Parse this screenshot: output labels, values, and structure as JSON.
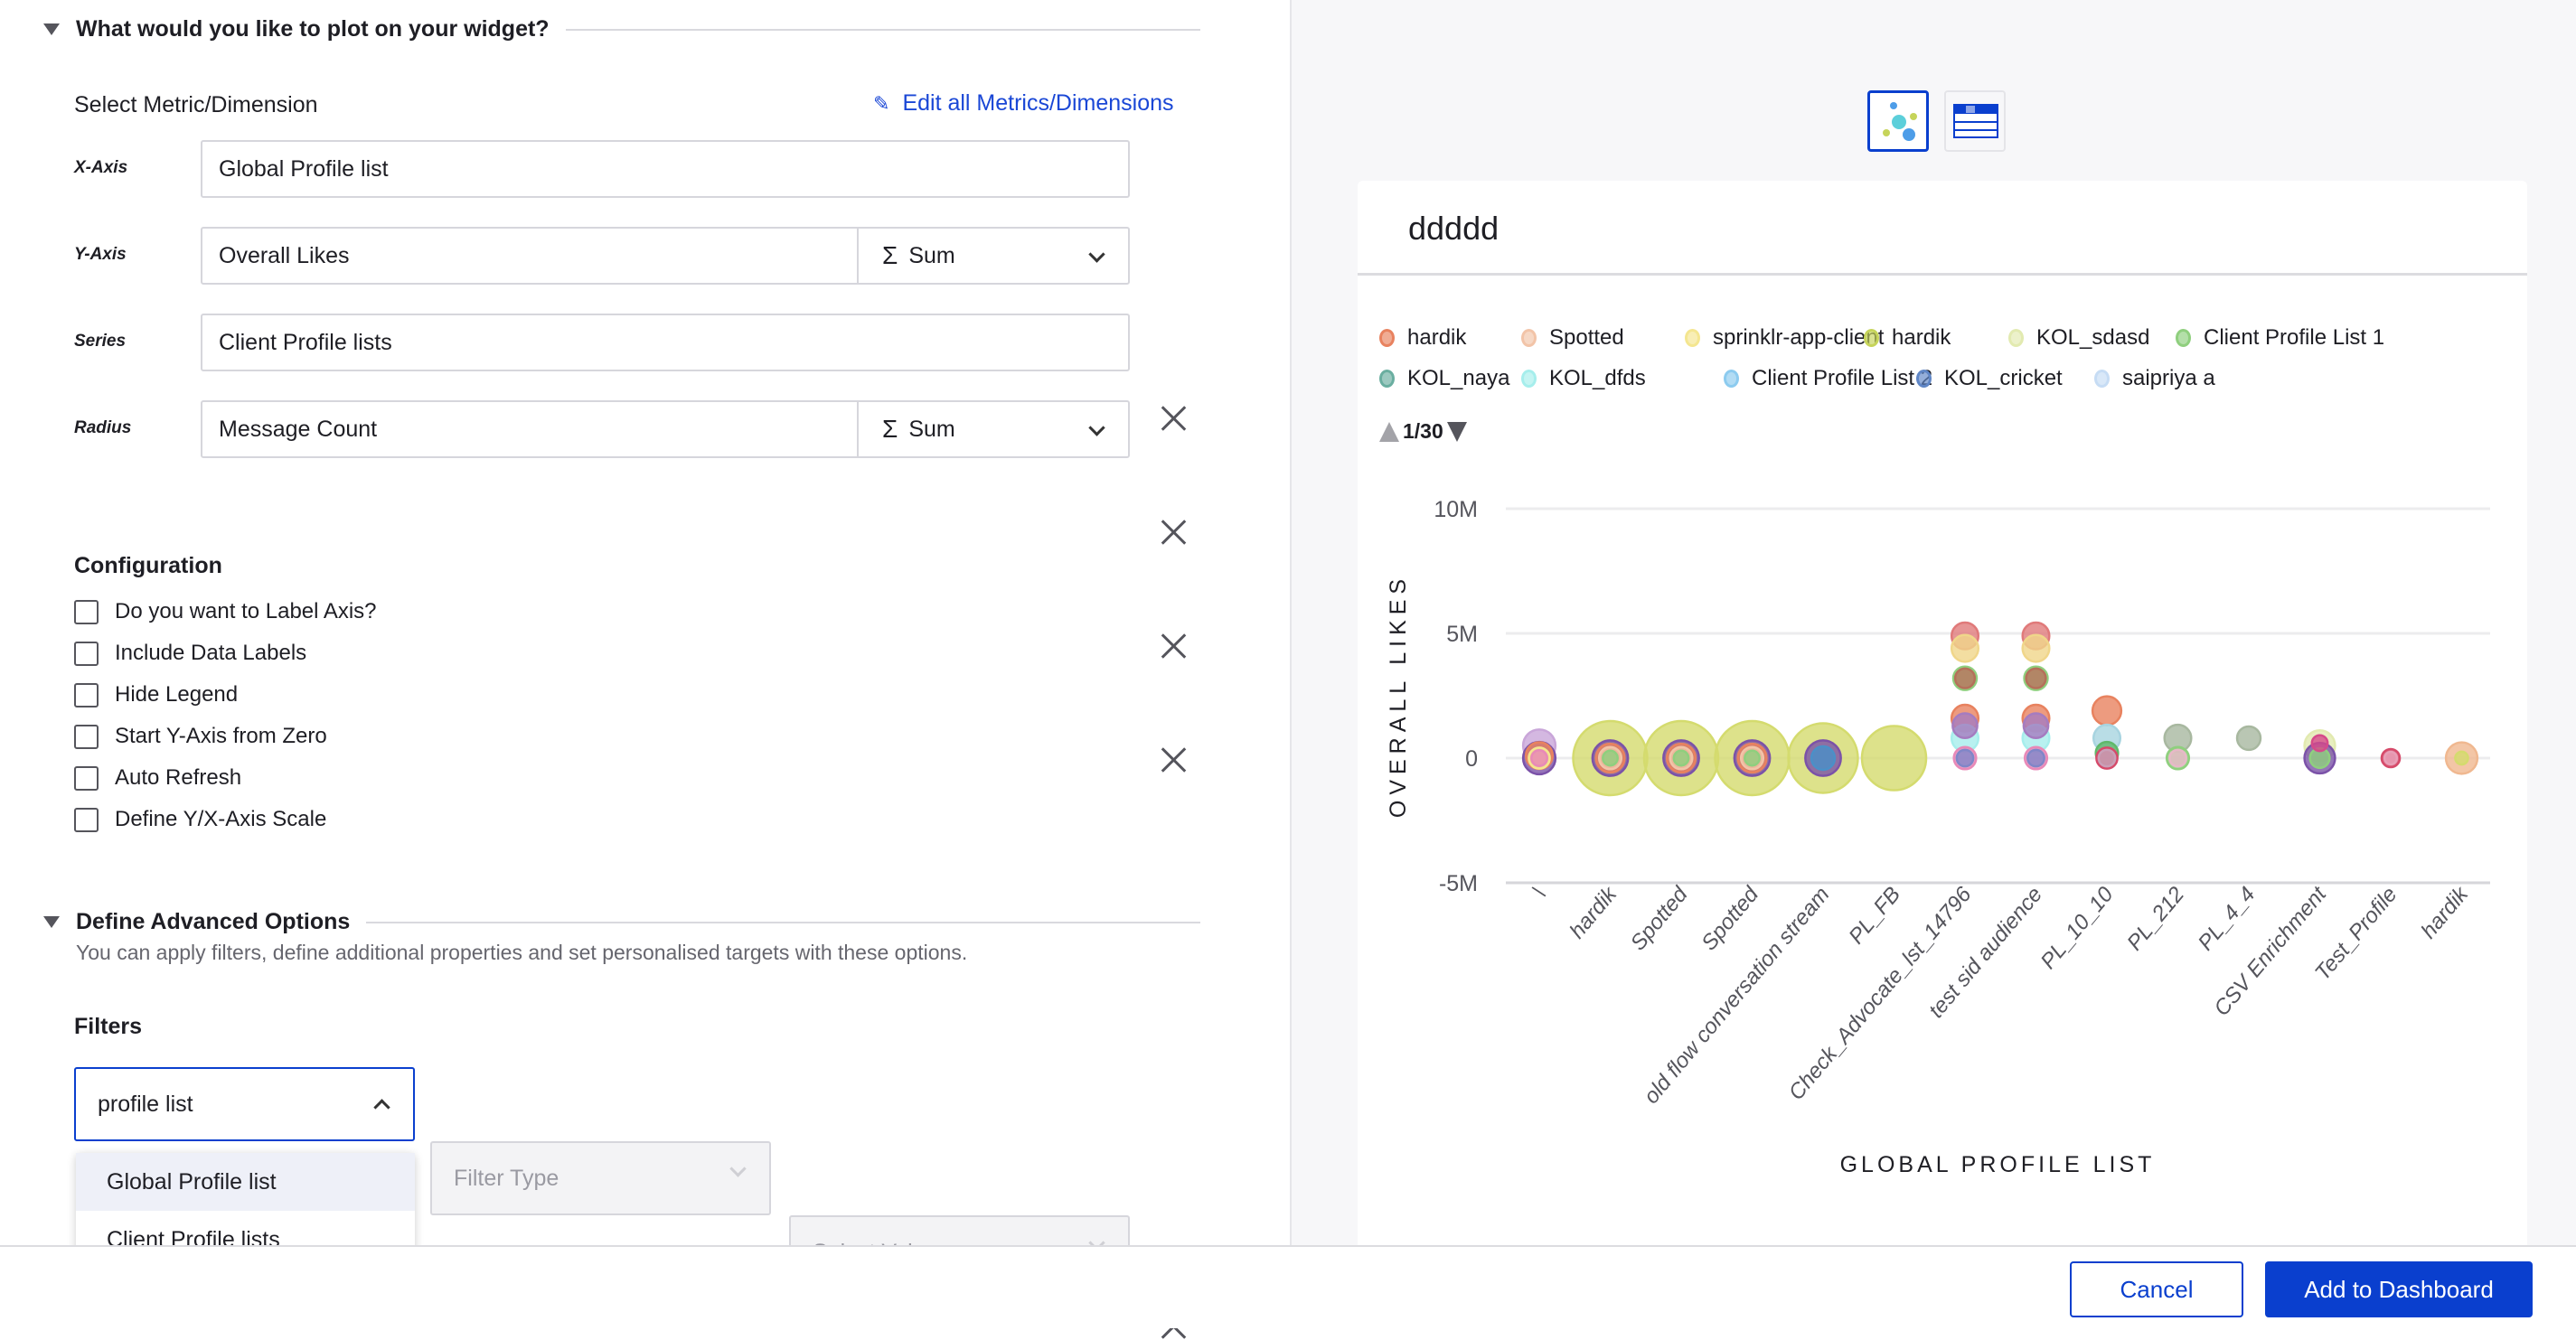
{
  "plot_section": {
    "title": "What would you like to plot on your widget?",
    "select_label": "Select Metric/Dimension",
    "edit_link": "Edit all Metrics/Dimensions",
    "rows": [
      {
        "label": "X-Axis",
        "value": "Global Profile list",
        "aggregation": null
      },
      {
        "label": "Y-Axis",
        "value": "Overall Likes",
        "aggregation": "Sum"
      },
      {
        "label": "Series",
        "value": "Client Profile lists",
        "aggregation": null
      },
      {
        "label": "Radius",
        "value": "Message Count",
        "aggregation": "Sum"
      }
    ],
    "sigma": "Σ"
  },
  "configuration": {
    "title": "Configuration",
    "options": [
      {
        "label": "Do you want to Label Axis?",
        "checked": false
      },
      {
        "label": "Include Data Labels",
        "checked": false
      },
      {
        "label": "Hide Legend",
        "checked": false
      },
      {
        "label": "Start Y-Axis from Zero",
        "checked": false
      },
      {
        "label": "Auto Refresh",
        "checked": false
      },
      {
        "label": "Define Y/X-Axis Scale",
        "checked": false
      }
    ]
  },
  "advanced": {
    "title": "Define Advanced Options",
    "subtitle": "You can apply filters, define additional properties and set personalised targets with these options.",
    "filters_label": "Filters",
    "filter_field": "profile list",
    "filter_type_placeholder": "Filter Type",
    "filter_values_placeholder": "Select Values",
    "dropdown_options": [
      "Global Profile list",
      "Client Profile lists"
    ],
    "highlighted_option": "Global Profile list"
  },
  "footer": {
    "cancel": "Cancel",
    "add": "Add to Dashboard"
  },
  "colors": {
    "accent": "#0a3fce",
    "link": "#1a47d6"
  },
  "widget": {
    "title": "ddddd",
    "view_types": [
      "bubble-chart-icon",
      "table-icon"
    ],
    "selected_view": "bubble-chart-icon",
    "legend_page": "1/30",
    "legend": [
      {
        "name": "hardik",
        "color": "#e8825f"
      },
      {
        "name": "Spotted",
        "color": "#f2c4a8"
      },
      {
        "name": "sprinklr-app-client",
        "color": "#f4e690"
      },
      {
        "name": "hardik",
        "color": "#c6d45a"
      },
      {
        "name": "KOL_sdasd",
        "color": "#e2eab0"
      },
      {
        "name": "Client Profile List 1",
        "color": "#8fcf7e"
      },
      {
        "name": "KOL_naya",
        "color": "#6aaea0"
      },
      {
        "name": "KOL_dfds",
        "color": "#a6eeec"
      },
      {
        "name": "Client Profile List 2",
        "color": "#8ccbef"
      },
      {
        "name": "KOL_cricket",
        "color": "#5f86c6"
      },
      {
        "name": "saipriya a",
        "color": "#c6dcf4"
      }
    ]
  },
  "chart_data": {
    "type": "bubble",
    "xlabel": "GLOBAL PROFILE LIST",
    "ylabel": "OVERALL LIKES",
    "radius_metric": "Message Count",
    "yticks": [
      {
        "v": 10,
        "label": "10M"
      },
      {
        "v": 5,
        "label": "5M"
      },
      {
        "v": 0,
        "label": "0"
      },
      {
        "v": -5,
        "label": "-5M"
      }
    ],
    "ylim": [
      -5,
      10
    ],
    "y_unit": "M",
    "grid": true,
    "categories": [
      "\\",
      "hardik",
      "Spotted",
      "Spotted",
      "old flow conversation stream",
      "PL_FB",
      "Check_Advocate_lst_14796",
      "test sid audience",
      "PL_10_10",
      "PL_212",
      "PL_4_4",
      "CSV Enrichment",
      "Test_Profile",
      "hardik"
    ],
    "points": [
      [
        {
          "y": 0.5,
          "r": 1900,
          "c": "#c9a6d9"
        },
        {
          "y": 0,
          "r": 1900,
          "c": "#7b52a8"
        },
        {
          "y": 0.1,
          "r": 1300,
          "c": "#e8825f"
        },
        {
          "y": 0,
          "r": 800,
          "c": "#f4e690"
        },
        {
          "y": 0,
          "r": 450,
          "c": "#e889b8"
        }
      ],
      [
        {
          "y": 0,
          "r": 10000,
          "c": "#d4db6e"
        },
        {
          "y": 0,
          "r": 2300,
          "c": "#7b52a8"
        },
        {
          "y": 0,
          "r": 1500,
          "c": "#e8825f"
        },
        {
          "y": 0,
          "r": 900,
          "c": "#f2c4a8"
        },
        {
          "y": 0,
          "r": 400,
          "c": "#8fcf7e"
        }
      ],
      [
        {
          "y": 0,
          "r": 10000,
          "c": "#d4db6e"
        },
        {
          "y": 0,
          "r": 2300,
          "c": "#7b52a8"
        },
        {
          "y": 0,
          "r": 1500,
          "c": "#e8825f"
        },
        {
          "y": 0,
          "r": 900,
          "c": "#f2c4a8"
        },
        {
          "y": 0,
          "r": 400,
          "c": "#8fcf7e"
        }
      ],
      [
        {
          "y": 0,
          "r": 10000,
          "c": "#d4db6e"
        },
        {
          "y": 0,
          "r": 2300,
          "c": "#7b52a8"
        },
        {
          "y": 0,
          "r": 1500,
          "c": "#e8825f"
        },
        {
          "y": 0,
          "r": 900,
          "c": "#f2c4a8"
        },
        {
          "y": 0,
          "r": 400,
          "c": "#8fcf7e"
        }
      ],
      [
        {
          "y": 0,
          "r": 8800,
          "c": "#d4db6e"
        },
        {
          "y": 0,
          "r": 2300,
          "c": "#7b52a8"
        },
        {
          "y": 0,
          "r": 1000,
          "c": "#4a90c8"
        }
      ],
      [
        {
          "y": 0,
          "r": 7500,
          "c": "#d4db6e"
        }
      ],
      [
        {
          "y": 4.9,
          "r": 1300,
          "c": "#e07a7a"
        },
        {
          "y": 4.4,
          "r": 1300,
          "c": "#f0d68a"
        },
        {
          "y": 3.2,
          "r": 1000,
          "c": "#8fcf7e"
        },
        {
          "y": 3.2,
          "r": 700,
          "c": "#b5705a"
        },
        {
          "y": 1.6,
          "r": 1300,
          "c": "#e8825f"
        },
        {
          "y": 0.8,
          "r": 1300,
          "c": "#a6eeec"
        },
        {
          "y": 1.3,
          "r": 1100,
          "c": "#a57cc0"
        },
        {
          "y": 0,
          "r": 900,
          "c": "#e889b8"
        },
        {
          "y": 0,
          "r": 500,
          "c": "#7f86c8"
        }
      ],
      [
        {
          "y": 4.9,
          "r": 1300,
          "c": "#e07a7a"
        },
        {
          "y": 4.4,
          "r": 1300,
          "c": "#f0d68a"
        },
        {
          "y": 3.2,
          "r": 1000,
          "c": "#8fcf7e"
        },
        {
          "y": 3.2,
          "r": 700,
          "c": "#b5705a"
        },
        {
          "y": 1.6,
          "r": 1300,
          "c": "#e8825f"
        },
        {
          "y": 0.8,
          "r": 1300,
          "c": "#a6eeec"
        },
        {
          "y": 1.3,
          "r": 1100,
          "c": "#a57cc0"
        },
        {
          "y": 0,
          "r": 900,
          "c": "#e889b8"
        },
        {
          "y": 0,
          "r": 500,
          "c": "#7f86c8"
        }
      ],
      [
        {
          "y": 1.9,
          "r": 1500,
          "c": "#e8825f"
        },
        {
          "y": 0.8,
          "r": 1300,
          "c": "#a8d4e0"
        },
        {
          "y": 0.2,
          "r": 900,
          "c": "#5fb86a"
        },
        {
          "y": 0,
          "r": 800,
          "c": "#d64a6a"
        },
        {
          "y": 0,
          "r": 500,
          "c": "#c9a0b8"
        }
      ],
      [
        {
          "y": 0.8,
          "r": 1300,
          "c": "#a8b8a0"
        },
        {
          "y": 0,
          "r": 900,
          "c": "#8fcf7e"
        },
        {
          "y": 0,
          "r": 500,
          "c": "#e8b8c8"
        }
      ],
      [
        {
          "y": 0.8,
          "r": 1000,
          "c": "#a8b8a0"
        }
      ],
      [
        {
          "y": 0.5,
          "r": 1700,
          "c": "#e2eab0"
        },
        {
          "y": 0,
          "r": 1700,
          "c": "#7b52a8"
        },
        {
          "y": 0,
          "r": 700,
          "c": "#8fcf7e"
        },
        {
          "y": 0.6,
          "r": 450,
          "c": "#d64a8a"
        }
      ],
      [
        {
          "y": 0,
          "r": 600,
          "c": "#d64a6a"
        },
        {
          "y": 0,
          "r": 280,
          "c": "#e8a0b8"
        }
      ],
      [
        {
          "y": 0,
          "r": 1800,
          "c": "#f0b890"
        },
        {
          "y": 0,
          "r": 300,
          "c": "#d4db6e"
        }
      ]
    ]
  }
}
